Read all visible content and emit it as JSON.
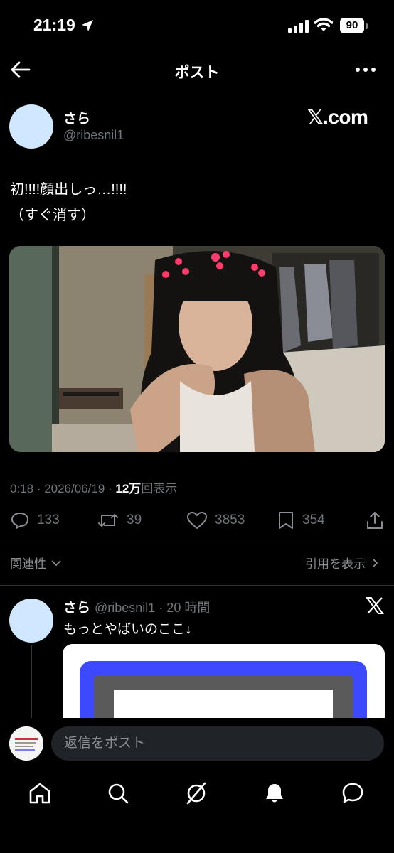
{
  "status": {
    "time": "21:19",
    "battery": "90"
  },
  "nav": {
    "title": "ポスト"
  },
  "post": {
    "author_name": "さら",
    "author_handle": "@ribesnil1",
    "brand": "𝕏.com",
    "text_line1": "初!!!!顔出しっ…!!!!",
    "text_line2": "（すぐ消す）",
    "meta_prefix": "0:18 · 2026/06/19 · ",
    "views_count": "12万",
    "views_label": "回表示",
    "stats": {
      "replies": "133",
      "reposts": "39",
      "likes": "3853",
      "bookmarks": "354"
    }
  },
  "sort": {
    "label": "関連性",
    "quotes_label": "引用を表示"
  },
  "reply": {
    "author_name": "さら",
    "author_meta": "@ribesnil1 · 20 時間",
    "text": "もっとやばいのここ↓"
  },
  "composer": {
    "placeholder": "返信をポスト"
  },
  "tabs": [
    "home-icon",
    "search-icon",
    "grok-icon",
    "notifications-icon",
    "messages-icon"
  ],
  "colors": {
    "background": "#000000",
    "text": "#e7e9ea",
    "muted": "#71767b",
    "avatar": "#cfe8ff",
    "card_accent": "#3c49ff"
  }
}
